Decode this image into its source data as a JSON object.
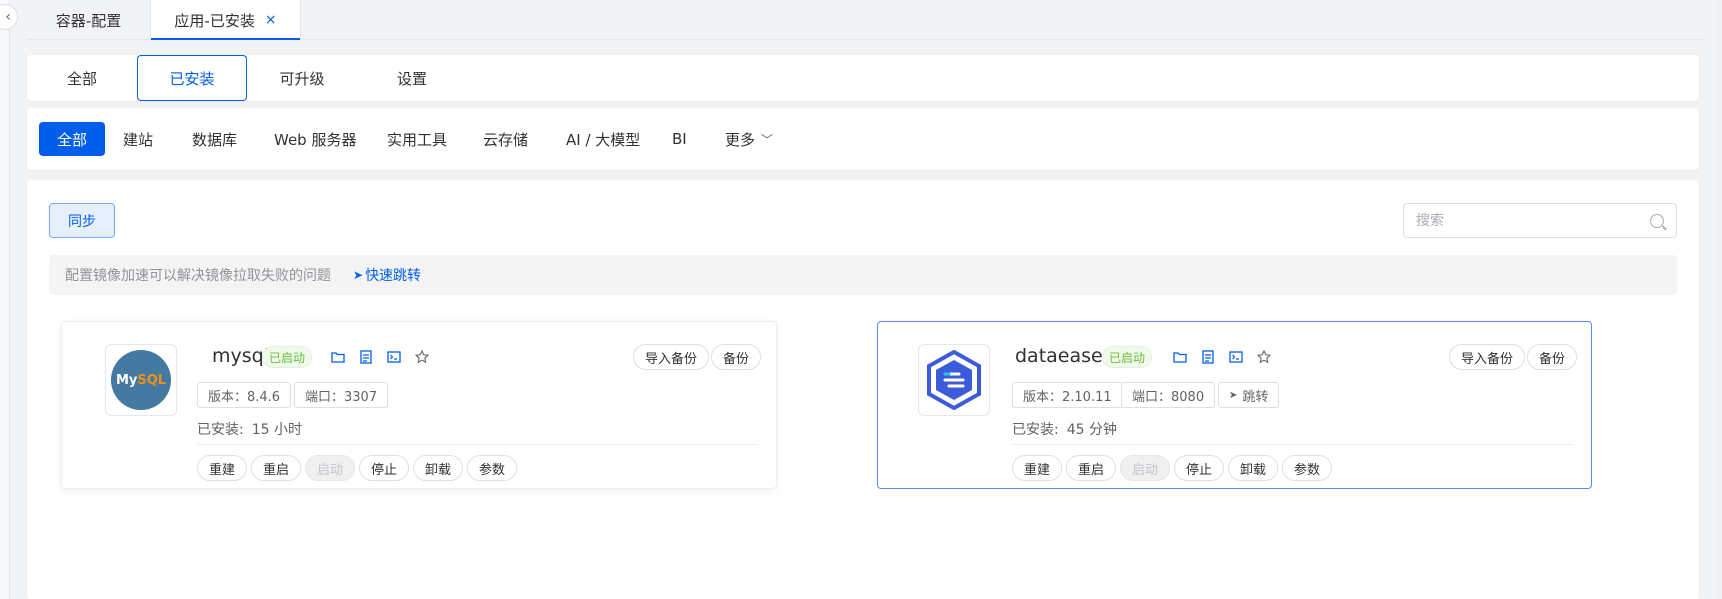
{
  "tabs": [
    {
      "label": "容器-配置"
    },
    {
      "label": "应用-已安装",
      "close_icon": "×"
    }
  ],
  "segments": [
    "全部",
    "已安装",
    "可升级",
    "设置"
  ],
  "categories": [
    "全部",
    "建站",
    "数据库",
    "Web 服务器",
    "实用工具",
    "云存储",
    "AI / 大模型",
    "BI",
    "更多"
  ],
  "toolbar": {
    "sync_label": "同步",
    "search_placeholder": "搜索"
  },
  "notice": {
    "text": "配置镜像加速可以解决镜像拉取失败的问题",
    "link": "快速跳转"
  },
  "apps": [
    {
      "name": "mysql",
      "logo_text_a": "My",
      "logo_text_b": "SQL",
      "status": "已启动",
      "version": "版本：8.4.6",
      "port": "端口：3307",
      "installed_label": "已安装:",
      "installed_time": "15 小时",
      "import_backup": "导入备份",
      "backup": "备份",
      "actions": [
        "重建",
        "重启",
        "启动",
        "停止",
        "卸载",
        "参数"
      ]
    },
    {
      "name": "dataease",
      "status": "已启动",
      "version": "版本：2.10.11",
      "port": "端口：8080",
      "jump": "跳转",
      "installed_label": "已安装:",
      "installed_time": "45 分钟",
      "import_backup": "导入备份",
      "backup": "备份",
      "actions": [
        "重建",
        "重启",
        "启动",
        "停止",
        "卸载",
        "参数"
      ]
    }
  ],
  "colors": {
    "primary": "#005eeb",
    "success": "#67c23a",
    "mysql": "#4479a1"
  }
}
